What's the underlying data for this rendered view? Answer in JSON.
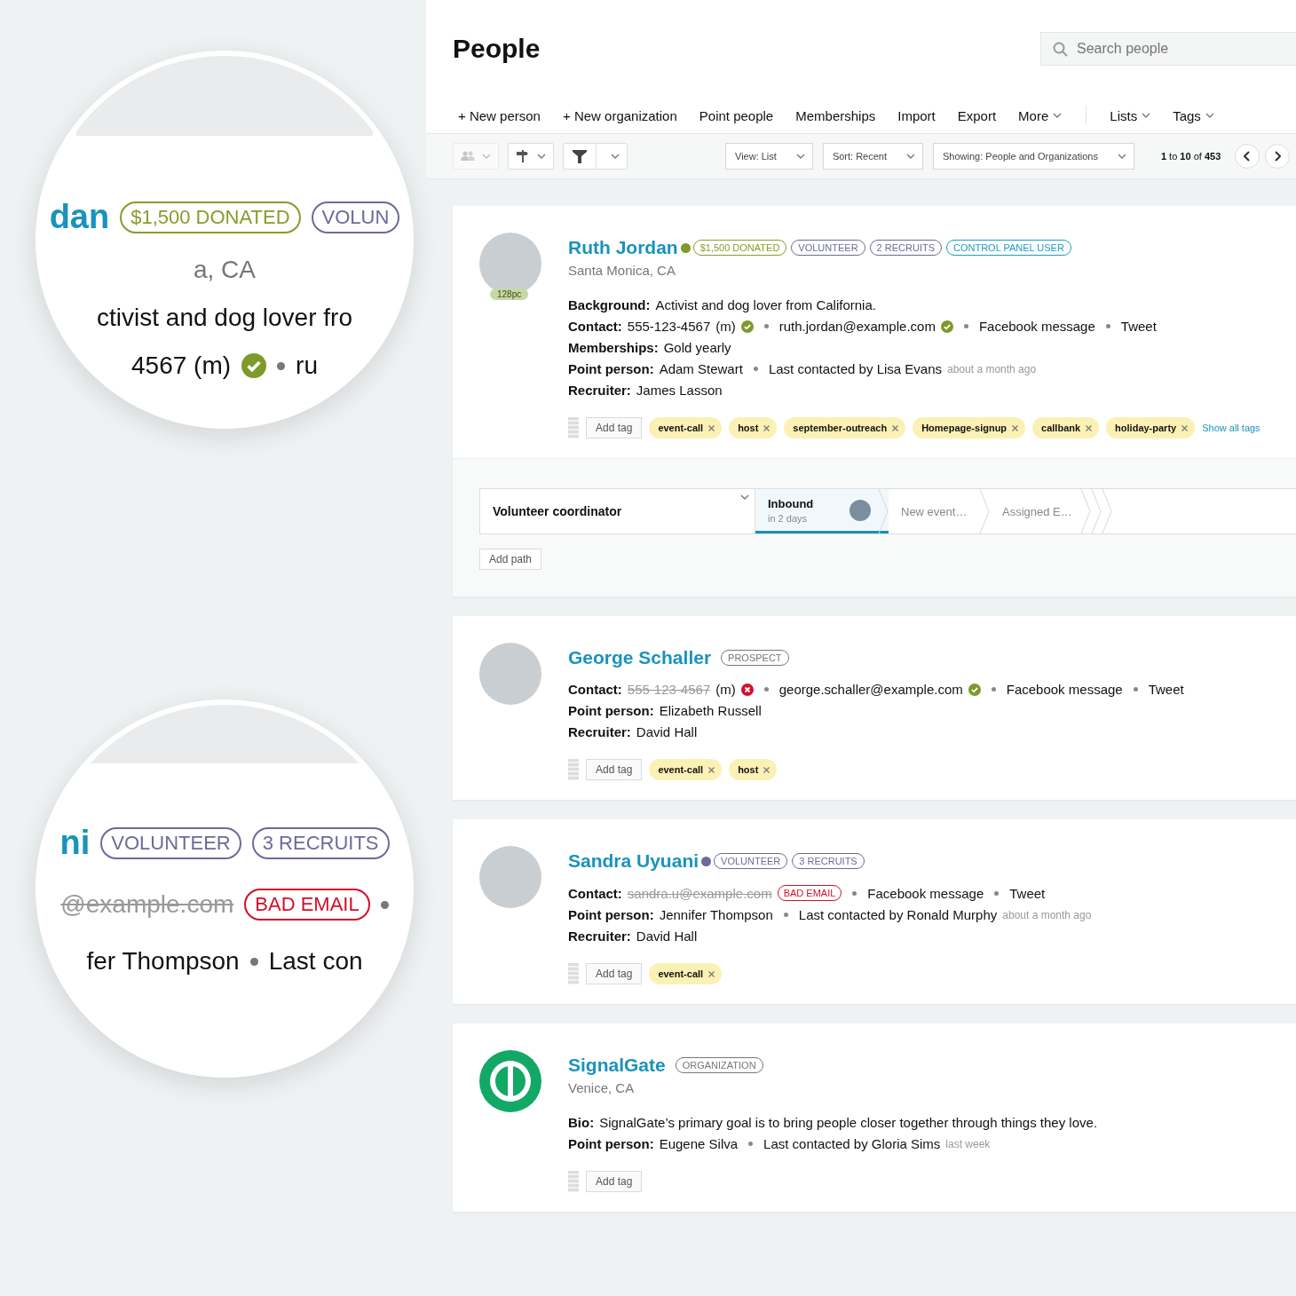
{
  "magnifiers": [
    {
      "rows": [
        {
          "segments": [
            {
              "kind": "name",
              "text": "dan"
            },
            {
              "kind": "badge",
              "text": "$1,500 DONATED",
              "color": "#8a9b2c"
            },
            {
              "kind": "badge",
              "text": "VOLUN",
              "color": "#6b6b9a"
            }
          ]
        },
        {
          "segments": [
            {
              "kind": "muted",
              "text": "a, CA"
            }
          ]
        },
        {
          "segments": [
            {
              "kind": "text",
              "text": "ctivist and dog lover fro"
            }
          ]
        },
        {
          "segments": [
            {
              "kind": "text",
              "text": "4567 (m)"
            },
            {
              "kind": "check"
            },
            {
              "kind": "dot"
            },
            {
              "kind": "text",
              "text": "ru"
            }
          ]
        }
      ]
    },
    {
      "rows": [
        {
          "segments": [
            {
              "kind": "name",
              "text": "ni"
            },
            {
              "kind": "badge",
              "text": "VOLUNTEER",
              "color": "#6b6b9a"
            },
            {
              "kind": "badge",
              "text": "3 RECRUITS",
              "color": "#6b6b9a"
            }
          ]
        },
        {
          "segments": [
            {
              "kind": "struck",
              "text": "@example.com"
            },
            {
              "kind": "flag",
              "text": "BAD EMAIL"
            },
            {
              "kind": "dot"
            }
          ]
        },
        {
          "segments": [
            {
              "kind": "text",
              "text": "fer Thompson"
            },
            {
              "kind": "dot"
            },
            {
              "kind": "text",
              "text": "Last con"
            }
          ]
        }
      ]
    }
  ],
  "header": {
    "title": "People",
    "search": {
      "placeholder": "Search people"
    }
  },
  "actions": [
    {
      "label": "+ New person",
      "dropdown": false
    },
    {
      "label": "+ New organization",
      "dropdown": false
    },
    {
      "label": "Point people",
      "dropdown": false
    },
    {
      "label": "Memberships",
      "dropdown": false
    },
    {
      "label": "Import",
      "dropdown": false
    },
    {
      "label": "Export",
      "dropdown": false
    },
    {
      "label": "More",
      "dropdown": true
    }
  ],
  "menus": [
    {
      "label": "Lists",
      "dropdown": true
    },
    {
      "label": "Tags",
      "dropdown": true
    }
  ],
  "toolbar": {
    "icon_buttons": [
      {
        "kind": "people",
        "disabled": true,
        "split": false
      },
      {
        "kind": "signpost",
        "disabled": false,
        "split": false
      },
      {
        "kind": "filter",
        "disabled": false,
        "split": true
      }
    ],
    "selects": [
      {
        "label": "View: List"
      },
      {
        "label": "Sort: Recent"
      },
      {
        "label": "Showing: People and Organizations"
      }
    ],
    "pagination": "**1** to **10** of **453**"
  },
  "people": [
    {
      "name": "Ruth Jordan",
      "color": "#7d9a2a",
      "avatar": {
        "kind": "photo",
        "label": "128pc"
      },
      "badges": [
        {
          "text": "$1,500 DONATED",
          "color": "#8a9b2c"
        },
        {
          "text": "VOLUNTEER",
          "color": "#6b6b9a"
        },
        {
          "text": "2 RECRUITS",
          "color": "#6b6b9a"
        },
        {
          "text": "CONTROL PANEL USER",
          "color": "#1e9bc4"
        }
      ],
      "location": "Santa Monica, CA",
      "fields": [
        {
          "label": "Background:",
          "items": [
            {
              "text": "Activist and dog lover from California."
            }
          ]
        },
        {
          "label": "Contact:",
          "items": [
            {
              "text": "555-123-4567",
              "note": "(m)",
              "verified": true,
              "struck": false
            },
            {
              "text": "ruth.jordan@example.com",
              "verified": true,
              "struck": false
            },
            {
              "text": "Facebook message"
            },
            {
              "text": "Tweet"
            }
          ]
        },
        {
          "label": "Memberships:",
          "items": [
            {
              "text": "Gold yearly"
            }
          ]
        },
        {
          "label": "Point person:",
          "items": [
            {
              "text": "Adam Stewart"
            },
            {
              "text": "Last contacted by Lisa Evans",
              "time": "about a month ago"
            }
          ]
        },
        {
          "label": "Recruiter:",
          "items": [
            {
              "text": "James Lasson"
            }
          ]
        }
      ],
      "add_tag": "Add tag",
      "tags": [
        "event-call",
        "host",
        "september-outreach",
        "Homepage-signup",
        "callbank",
        "holiday-party"
      ],
      "show_all": "Show all tags",
      "path": {
        "title": "Volunteer coordinator",
        "steps": [
          {
            "kind": "stage",
            "title": "Inbound",
            "subtitle": "in 2 days",
            "assignee": true,
            "selected": true
          },
          {
            "kind": "stage",
            "title": "New event…",
            "selected": false
          },
          {
            "kind": "stage",
            "title": "Assigned E…",
            "selected": false
          },
          {
            "kind": "blank",
            "selected": false
          },
          {
            "kind": "blank",
            "selected": false
          }
        ],
        "add_button": "Add path"
      }
    },
    {
      "name": "George Schaller",
      "avatar": {
        "kind": "photo"
      },
      "badges": [
        {
          "text": "PROSPECT",
          "color": "#777777"
        }
      ],
      "fields": [
        {
          "label": "Contact:",
          "items": [
            {
              "text": "555-123-4567",
              "note": "(m)",
              "verified": false,
              "struck": true
            },
            {
              "text": "george.schaller@example.com",
              "verified": true,
              "struck": false
            },
            {
              "text": "Facebook message"
            },
            {
              "text": "Tweet"
            }
          ]
        },
        {
          "label": "Point person:",
          "items": [
            {
              "text": "Elizabeth Russell"
            }
          ]
        },
        {
          "label": "Recruiter:",
          "items": [
            {
              "text": "David Hall"
            }
          ]
        }
      ],
      "add_tag": "Add tag",
      "tags": [
        "event-call",
        "host"
      ]
    },
    {
      "name": "Sandra Uyuani",
      "color": "#6b6b9a",
      "avatar": {
        "kind": "photo"
      },
      "badges": [
        {
          "text": "VOLUNTEER",
          "color": "#6b6b9a"
        },
        {
          "text": "3 RECRUITS",
          "color": "#6b6b9a"
        }
      ],
      "fields": [
        {
          "label": "Contact:",
          "items": [
            {
              "text": "sandra.u@example.com",
              "struck": true,
              "flag": "BAD EMAIL"
            },
            {
              "text": "Facebook message"
            },
            {
              "text": "Tweet"
            }
          ]
        },
        {
          "label": "Point person:",
          "items": [
            {
              "text": "Jennifer Thompson"
            },
            {
              "text": "Last contacted by Ronald Murphy",
              "time": "about a month ago"
            }
          ]
        },
        {
          "label": "Recruiter:",
          "items": [
            {
              "text": "David Hall"
            }
          ]
        }
      ],
      "add_tag": "Add tag",
      "tags": [
        "event-call"
      ]
    },
    {
      "name": "SignalGate",
      "avatar": {
        "kind": "logo"
      },
      "badges": [
        {
          "text": "ORGANIZATION",
          "color": "#777777"
        }
      ],
      "location": "Venice, CA",
      "fields": [
        {
          "label": "Bio:",
          "items": [
            {
              "text": "SignalGate’s primary goal is to bring people closer together through things they love."
            }
          ]
        },
        {
          "label": "Point person:",
          "items": [
            {
              "text": "Eugene Silva"
            },
            {
              "text": "Last contacted by Gloria Sims",
              "time": "last week"
            }
          ]
        }
      ],
      "add_tag": "Add tag"
    }
  ]
}
